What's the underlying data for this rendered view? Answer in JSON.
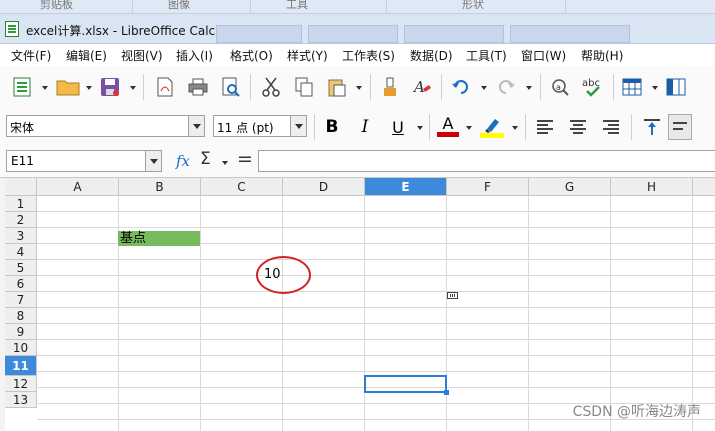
{
  "background_ribbon": {
    "labels": [
      "剪贴板",
      "图像",
      "工具",
      "形状"
    ]
  },
  "window": {
    "title": "excel计算.xlsx - LibreOffice Calc"
  },
  "menu": {
    "items": [
      "文件(F)",
      "编辑(E)",
      "视图(V)",
      "插入(I)",
      "格式(O)",
      "样式(Y)",
      "工作表(S)",
      "数据(D)",
      "工具(T)",
      "窗口(W)",
      "帮助(H)"
    ]
  },
  "formatting": {
    "font_name": "宋体",
    "font_size": "11 点 (pt)",
    "bold": "B",
    "italic": "I",
    "underline": "U",
    "font_color_letter": "A",
    "font_color": "#cc0000",
    "highlight_color": "#ffff00"
  },
  "formula_bar": {
    "name_box": "E11",
    "function_wizard": "fx",
    "sum_symbol": "Σ",
    "equals_symbol": "=",
    "formula_value": ""
  },
  "grid": {
    "columns": [
      "A",
      "B",
      "C",
      "D",
      "E",
      "F",
      "G",
      "H"
    ],
    "rows": [
      "1",
      "2",
      "3",
      "4",
      "5",
      "6",
      "7",
      "8",
      "9",
      "10",
      "11",
      "12",
      "13"
    ],
    "active_column": "E",
    "active_row": "11",
    "cells": {
      "B3": "基点",
      "C5": "10"
    },
    "highlight_color": "#77bb5e",
    "annotation_color": "#d42020"
  },
  "watermark": "CSDN @听海边涛声"
}
